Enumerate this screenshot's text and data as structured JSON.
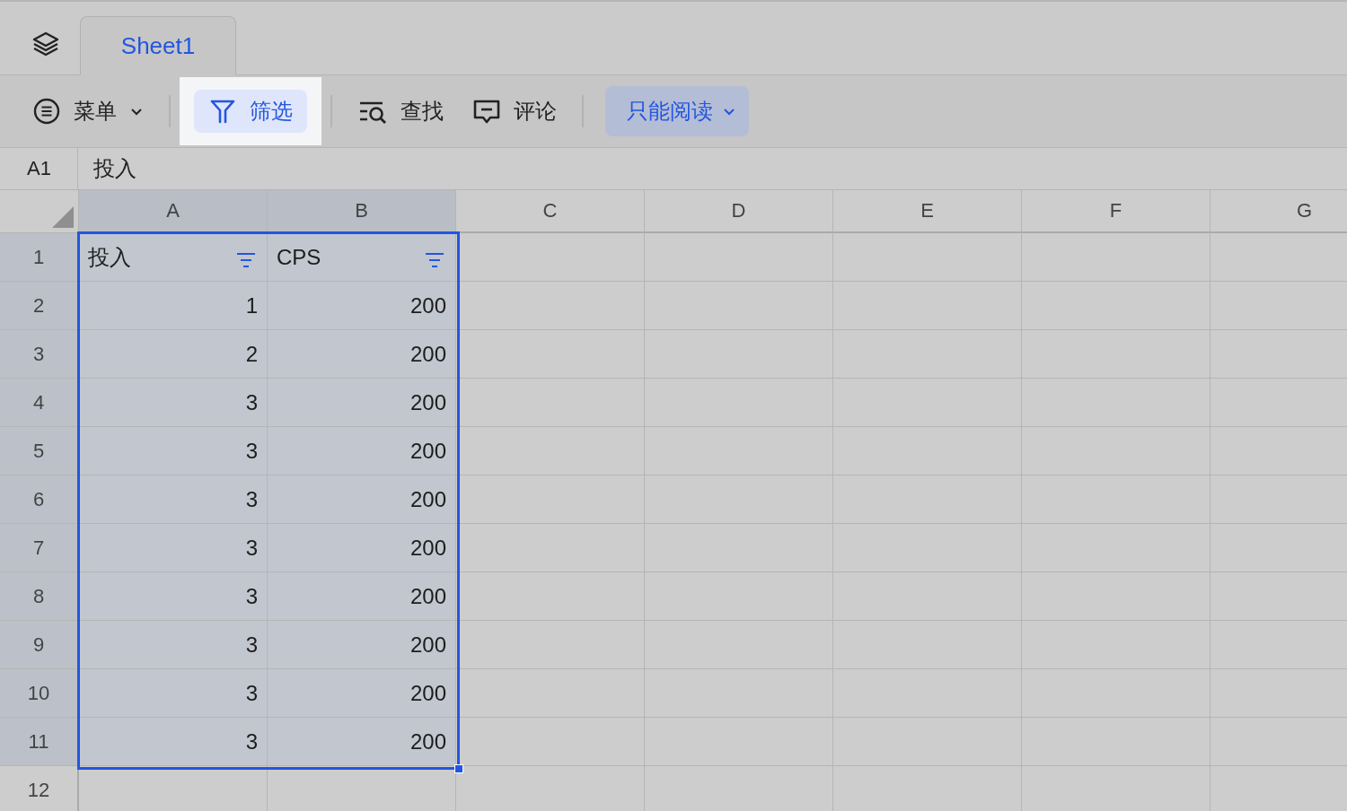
{
  "sheet_tabs": [
    {
      "label": "Sheet1",
      "selected": true
    }
  ],
  "toolbar": [
    {
      "kind": "menu",
      "label": "菜单",
      "selected": false
    },
    {
      "kind": "filter",
      "label": "筛选",
      "selected": true
    },
    {
      "kind": "find",
      "label": "查找",
      "selected": false
    },
    {
      "kind": "comment",
      "label": "评论",
      "selected": false
    },
    {
      "kind": "mode",
      "label": "只能阅读",
      "selected": false
    }
  ],
  "formula_bar": {
    "cell_ref": "A1",
    "value": "投入"
  },
  "columns": [
    {
      "label": "A",
      "selected": true
    },
    {
      "label": "B",
      "selected": true
    },
    {
      "label": "C",
      "selected": false
    },
    {
      "label": "D",
      "selected": false
    },
    {
      "label": "E",
      "selected": false
    },
    {
      "label": "F",
      "selected": false
    },
    {
      "label": "G",
      "selected": false
    }
  ],
  "rows": [
    {
      "number": "1",
      "selected": true,
      "cells": [
        {
          "text": "投入",
          "kind": "text",
          "filter": true
        },
        {
          "text": "CPS",
          "kind": "text",
          "filter": true
        }
      ]
    },
    {
      "number": "2",
      "selected": true,
      "cells": [
        {
          "text": "1",
          "kind": "number",
          "filter": false
        },
        {
          "text": "200",
          "kind": "number",
          "filter": false
        }
      ]
    },
    {
      "number": "3",
      "selected": true,
      "cells": [
        {
          "text": "2",
          "kind": "number",
          "filter": false
        },
        {
          "text": "200",
          "kind": "number",
          "filter": false
        }
      ]
    },
    {
      "number": "4",
      "selected": true,
      "cells": [
        {
          "text": "3",
          "kind": "number",
          "filter": false
        },
        {
          "text": "200",
          "kind": "number",
          "filter": false
        }
      ]
    },
    {
      "number": "5",
      "selected": true,
      "cells": [
        {
          "text": "3",
          "kind": "number",
          "filter": false
        },
        {
          "text": "200",
          "kind": "number",
          "filter": false
        }
      ]
    },
    {
      "number": "6",
      "selected": true,
      "cells": [
        {
          "text": "3",
          "kind": "number",
          "filter": false
        },
        {
          "text": "200",
          "kind": "number",
          "filter": false
        }
      ]
    },
    {
      "number": "7",
      "selected": true,
      "cells": [
        {
          "text": "3",
          "kind": "number",
          "filter": false
        },
        {
          "text": "200",
          "kind": "number",
          "filter": false
        }
      ]
    },
    {
      "number": "8",
      "selected": true,
      "cells": [
        {
          "text": "3",
          "kind": "number",
          "filter": false
        },
        {
          "text": "200",
          "kind": "number",
          "filter": false
        }
      ]
    },
    {
      "number": "9",
      "selected": true,
      "cells": [
        {
          "text": "3",
          "kind": "number",
          "filter": false
        },
        {
          "text": "200",
          "kind": "number",
          "filter": false
        }
      ]
    },
    {
      "number": "10",
      "selected": true,
      "cells": [
        {
          "text": "3",
          "kind": "number",
          "filter": false
        },
        {
          "text": "200",
          "kind": "number",
          "filter": false
        }
      ]
    },
    {
      "number": "11",
      "selected": true,
      "cells": [
        {
          "text": "3",
          "kind": "number",
          "filter": false
        },
        {
          "text": "200",
          "kind": "number",
          "filter": false
        }
      ]
    },
    {
      "number": "12",
      "selected": false
    }
  ]
}
